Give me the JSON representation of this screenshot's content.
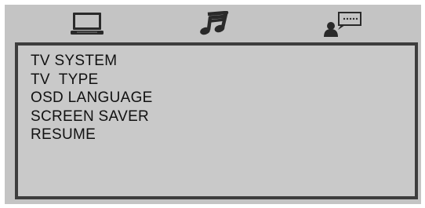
{
  "tabs": [
    {
      "icon": "tv-monitor-icon",
      "name": "general-setup"
    },
    {
      "icon": "music-note-icon",
      "name": "audio-setup"
    },
    {
      "icon": "speaker-person-icon",
      "name": "speaker-setup"
    }
  ],
  "menu": {
    "items": [
      {
        "label": "TV SYSTEM"
      },
      {
        "label": "TV  TYPE"
      },
      {
        "label": "OSD LANGUAGE"
      },
      {
        "label": "SCREEN SAVER"
      },
      {
        "label": "RESUME"
      }
    ]
  },
  "colors": {
    "frame": "#c4c4c4",
    "panel": "#c9c9c9",
    "panel_border": "#3d3d3d",
    "icon": "#2a2a2a",
    "text": "#111111"
  }
}
